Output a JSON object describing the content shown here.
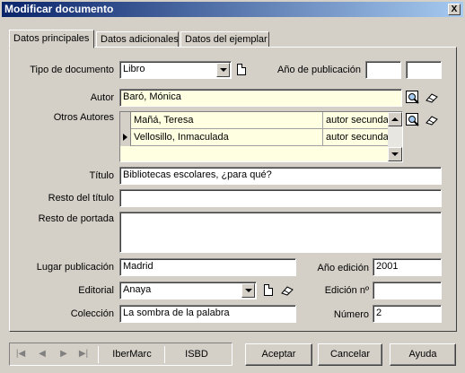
{
  "window": {
    "title": "Modificar documento",
    "close_label": "X"
  },
  "tabs": [
    {
      "label": "Datos principales"
    },
    {
      "label": "Datos adicionales"
    },
    {
      "label": "Datos del ejemplar"
    }
  ],
  "form": {
    "tipo_documento": {
      "label": "Tipo de documento",
      "value": "Libro"
    },
    "anio_publicacion": {
      "label": "Año de publicación",
      "value1": "",
      "value2": ""
    },
    "autor": {
      "label": "Autor",
      "value": "Baró, Mónica"
    },
    "otros_autores": {
      "label": "Otros Autores",
      "rows": [
        {
          "name": "Mañá, Teresa",
          "role": "autor secunda"
        },
        {
          "name": "Vellosillo, Inmaculada",
          "role": "autor secunda"
        }
      ]
    },
    "titulo": {
      "label": "Título",
      "value": "Bibliotecas escolares, ¿para qué?"
    },
    "resto_titulo": {
      "label": "Resto del título",
      "value": ""
    },
    "resto_portada": {
      "label": "Resto de portada",
      "value": ""
    },
    "lugar_publicacion": {
      "label": "Lugar publicación",
      "value": "Madrid"
    },
    "anio_edicion": {
      "label": "Año edición",
      "value": "2001"
    },
    "editorial": {
      "label": "Editorial",
      "value": "Anaya"
    },
    "edicion_no": {
      "label": "Edición nº",
      "value": ""
    },
    "coleccion": {
      "label": "Colección",
      "value": "La sombra de la palabra"
    },
    "numero": {
      "label": "Número",
      "value": "2"
    }
  },
  "bottom": {
    "nav_first": "|◀",
    "nav_prev": "◀",
    "nav_next": "▶",
    "nav_last": "▶|",
    "ibermarc": "IberMarc",
    "isbd": "ISBD"
  },
  "buttons": {
    "aceptar": "Aceptar",
    "cancelar": "Cancelar",
    "ayuda": "Ayuda"
  },
  "icons": [
    "new-document-icon",
    "search-icon",
    "eraser-icon",
    "dropdown-arrow-icon"
  ],
  "colors": {
    "titlebar_start": "#0a246a",
    "titlebar_end": "#a6caf0",
    "face": "#d4d0c8",
    "highlight_field": "#ffffe1"
  }
}
